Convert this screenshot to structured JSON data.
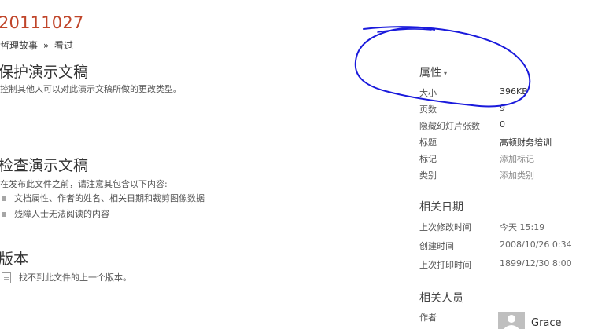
{
  "document": {
    "title": "20111027",
    "breadcrumb": [
      "哲理故事",
      "»",
      "看过"
    ]
  },
  "sections": {
    "protect": {
      "title": "保护演示文稿",
      "description": "控制其他人可以对此演示文稿所做的更改类型。"
    },
    "inspect": {
      "title": "检查演示文稿",
      "description": "在发布此文件之前，请注意其包含以下内容:",
      "bullets": [
        "文档属性、作者的姓名、相关日期和裁剪图像数据",
        "残障人士无法阅读的内容"
      ]
    },
    "versions": {
      "title": "版本",
      "message": "找不到此文件的上一个版本。"
    }
  },
  "properties": {
    "heading": "属性",
    "heading_caret": "▾",
    "rows": [
      {
        "label": "大小",
        "value": "396KB"
      },
      {
        "label": "页数",
        "value": "9"
      },
      {
        "label": "隐藏幻灯片张数",
        "value": "0"
      },
      {
        "label": "标题",
        "value": "高顿财务培训"
      },
      {
        "label": "标记",
        "value": "添加标记"
      },
      {
        "label": "类别",
        "value": "添加类别"
      }
    ]
  },
  "related_dates": {
    "heading": "相关日期",
    "rows": [
      {
        "label": "上次修改时间",
        "value": "今天 15:19"
      },
      {
        "label": "创建时间",
        "value": "2008/10/26 0:34"
      },
      {
        "label": "上次打印时间",
        "value": "1899/12/30 8:00"
      }
    ]
  },
  "related_people": {
    "heading": "相关人员",
    "author_label": "作者",
    "author_name": "Grace"
  },
  "colors": {
    "title": "#c0452a",
    "annotation": "#1a1adc",
    "link": "#8a8a8a"
  }
}
